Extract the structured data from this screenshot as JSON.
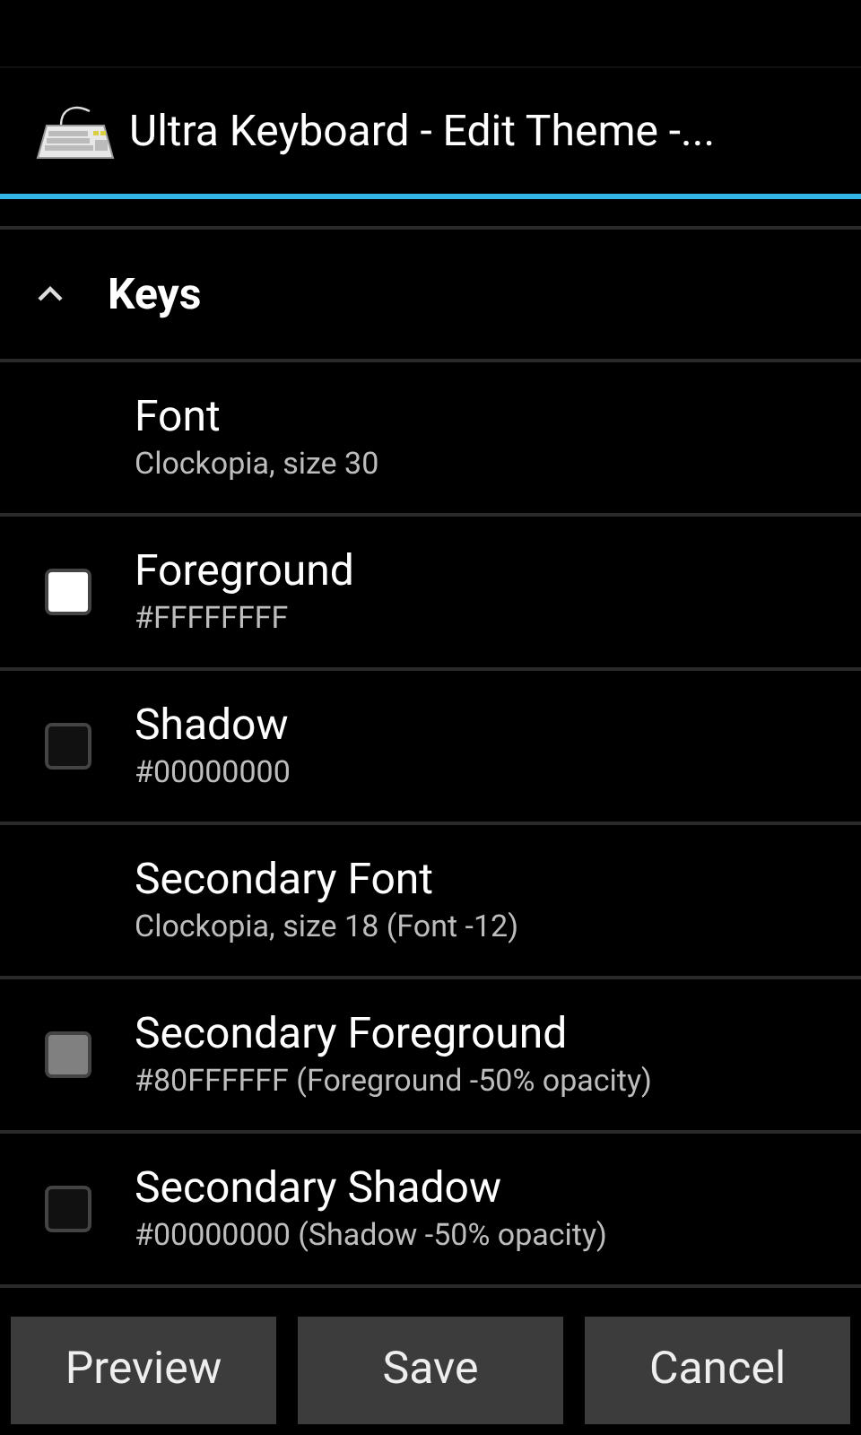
{
  "window": {
    "title": "Ultra Keyboard - Edit Theme -..."
  },
  "section": {
    "title": "Keys",
    "expanded": true
  },
  "items": [
    {
      "kind": "text",
      "title": "Font",
      "summary": "Clockopia, size 30"
    },
    {
      "kind": "color",
      "title": "Foreground",
      "summary": "#FFFFFFFF",
      "color": "#ffffff"
    },
    {
      "kind": "color",
      "title": "Shadow",
      "summary": "#00000000",
      "color": "#111111"
    },
    {
      "kind": "text",
      "title": "Secondary Font",
      "summary": "Clockopia, size 18 (Font -12)"
    },
    {
      "kind": "color",
      "title": "Secondary Foreground",
      "summary": "#80FFFFFF (Foreground -50% opacity)",
      "color": "#808080"
    },
    {
      "kind": "color",
      "title": "Secondary Shadow",
      "summary": "#00000000 (Shadow -50% opacity)",
      "color": "#111111"
    }
  ],
  "buttons": [
    "Preview",
    "Save",
    "Cancel"
  ]
}
